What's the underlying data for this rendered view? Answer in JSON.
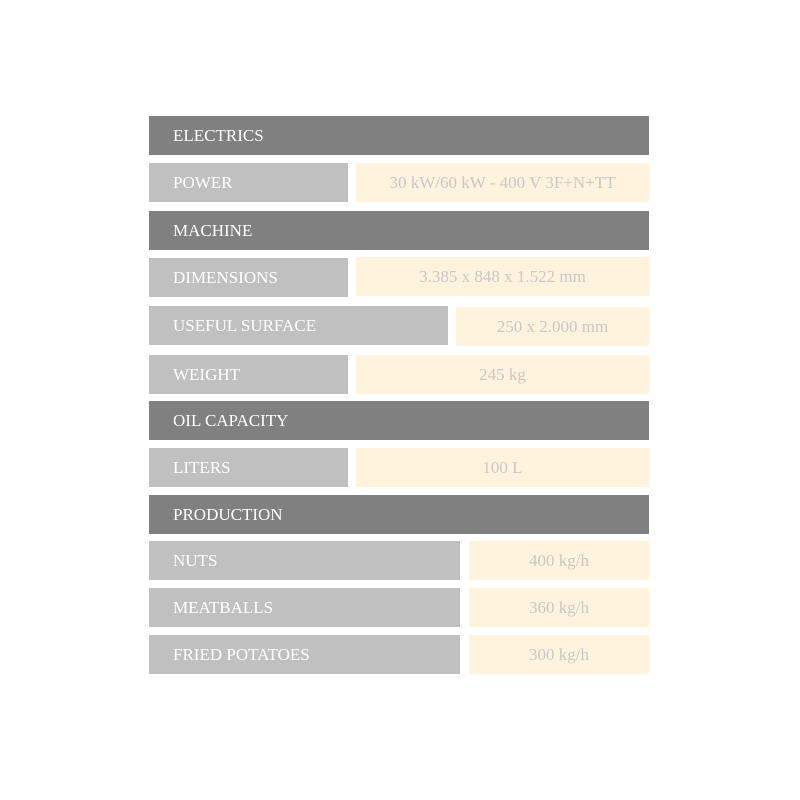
{
  "sections": [
    {
      "title": "ELECTRICS",
      "rows": [
        {
          "label": "POWER",
          "value": "30 kW/60 kW - 400 V 3F+N+TT"
        }
      ]
    },
    {
      "title": "MACHINE",
      "rows": [
        {
          "label": "DIMENSIONS",
          "value": "3.385 x 848 x 1.522 mm"
        },
        {
          "label": "USEFUL SURFACE",
          "value": "250 x 2.000 mm"
        },
        {
          "label": "WEIGHT",
          "value": "245 kg"
        }
      ]
    },
    {
      "title": "OIL CAPACITY",
      "rows": [
        {
          "label": "LITERS",
          "value": "100 L"
        }
      ]
    },
    {
      "title": "PRODUCTION",
      "rows": [
        {
          "label": "NUTS",
          "value": "400 kg/h"
        },
        {
          "label": "MEATBALLS",
          "value": "360 kg/h"
        },
        {
          "label": "FRIED POTATOES",
          "value": "300 kg/h"
        }
      ]
    }
  ],
  "colors": {
    "header": "#808080",
    "label": "#c0c0c0",
    "value_bg": "#fff3de",
    "value_text": "#c8c8c8"
  }
}
